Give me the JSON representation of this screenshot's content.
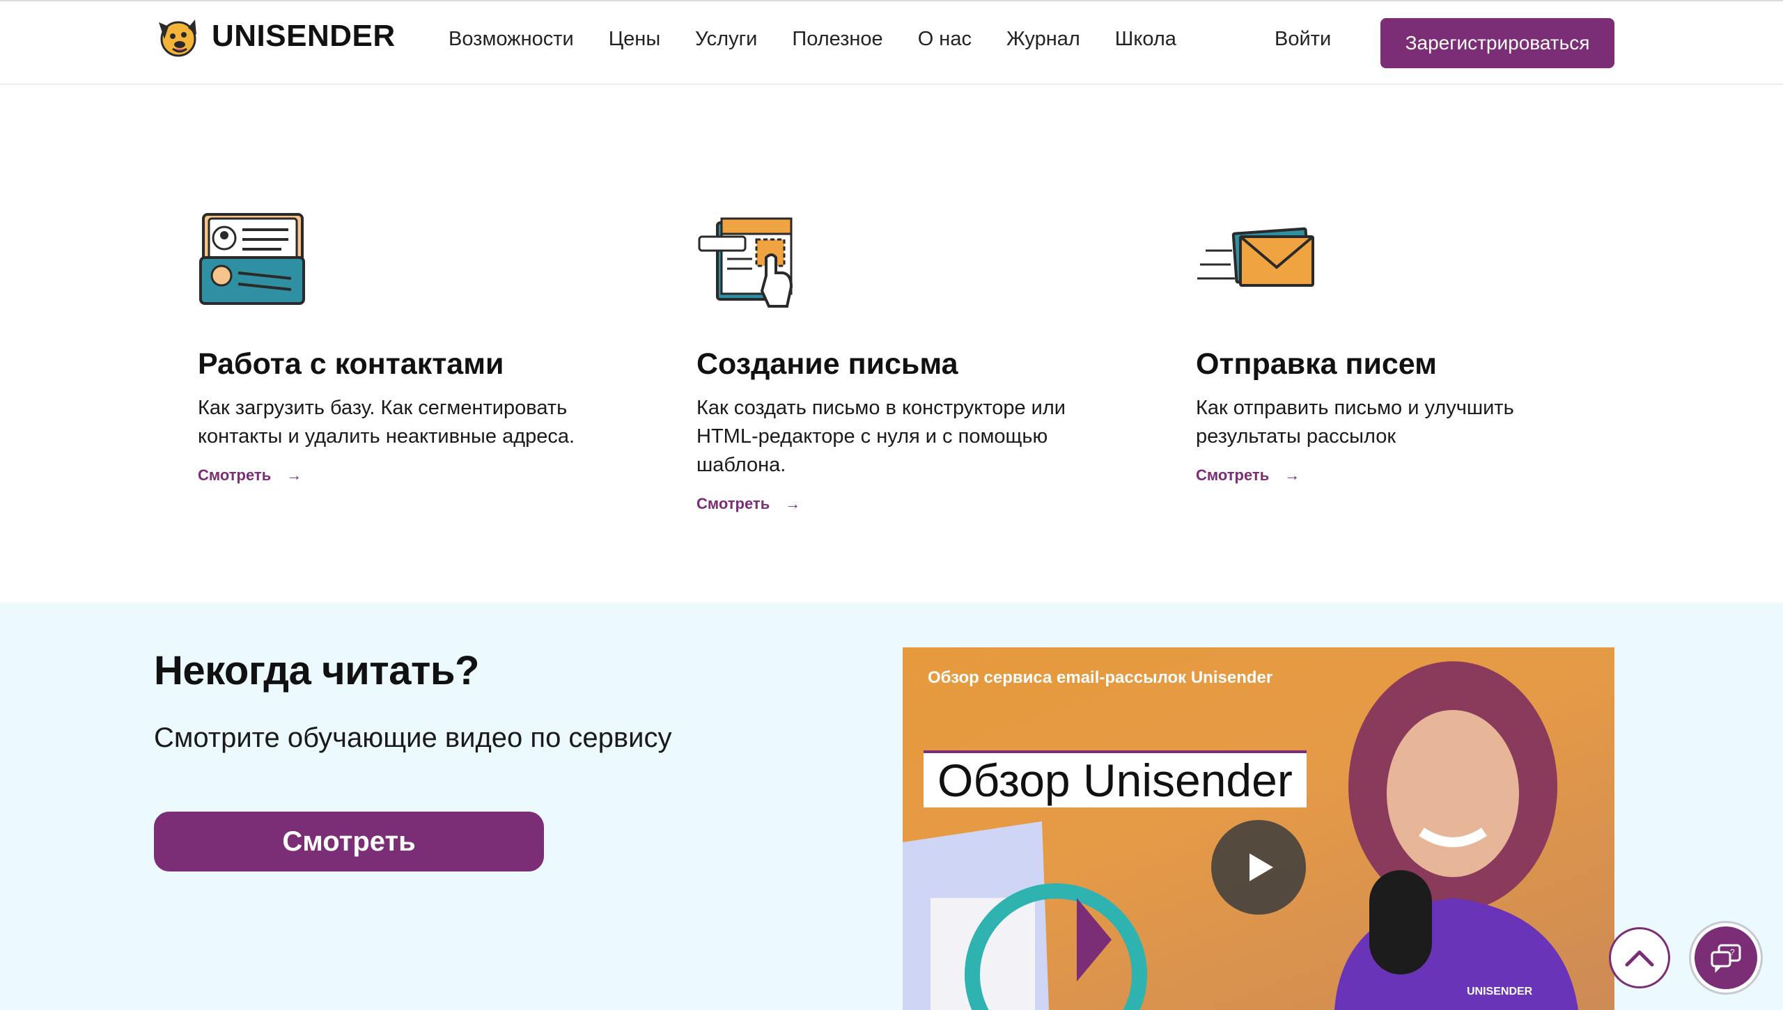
{
  "header": {
    "logo_text": "UNISENDER",
    "nav": [
      "Возможности",
      "Цены",
      "Услуги",
      "Полезное",
      "О нас",
      "Журнал",
      "Школа"
    ],
    "login": "Войти",
    "register": "Зарегистрироваться"
  },
  "cards": [
    {
      "title": "Работа с контактами",
      "text": "Как загрузить базу. Как сегментировать контакты и удалить неактивные адреса.",
      "link": "Смотреть",
      "arrow": "→",
      "icon": "contacts-cards-icon"
    },
    {
      "title": "Создание письма",
      "text": "Как создать письмо в конструкторе или HTML-редакторе с нуля и с помощью шаблона.",
      "link": "Смотреть",
      "arrow": "→",
      "icon": "email-builder-icon"
    },
    {
      "title": "Отправка писем",
      "text": "Как отправить письмо и улучшить результаты рассылок",
      "link": "Смотреть",
      "arrow": "→",
      "icon": "envelope-send-icon"
    }
  ],
  "lower": {
    "title": "Некогда читать?",
    "subtitle": "Смотрите обучающие видео по сервису",
    "button": "Смотреть"
  },
  "video": {
    "title": "Обзор сервиса email-рассылок Unisender",
    "banner": "Обзор Unisender",
    "watermark": "UNISENDER"
  },
  "colors": {
    "brand": "#7b2d75",
    "lower_bg": "#ecf9fd",
    "video_bg": "#e79a3c"
  }
}
